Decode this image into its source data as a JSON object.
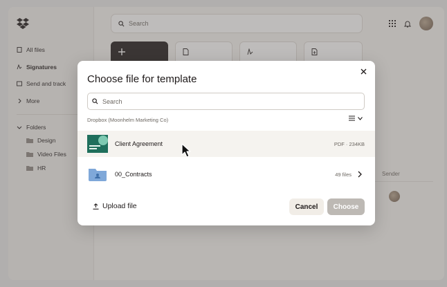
{
  "app": {
    "sidebar": {
      "items": [
        {
          "label": "All files",
          "icon": "file-icon"
        },
        {
          "label": "Signatures",
          "icon": "signature-icon"
        },
        {
          "label": "Send and track",
          "icon": "send-icon"
        },
        {
          "label": "More",
          "icon": "chevron-right-icon"
        }
      ],
      "folders_label": "Folders",
      "folders": [
        {
          "label": "Design"
        },
        {
          "label": "Video Files"
        },
        {
          "label": "HR"
        }
      ]
    },
    "header": {
      "search_placeholder": "Search"
    },
    "table": {
      "sender_header": "Sender"
    }
  },
  "modal": {
    "title": "Choose file for template",
    "search_placeholder": "Search",
    "breadcrumb": "Dropbox (Moonhelm Marketing Co)",
    "files": [
      {
        "name": "Client Agreement",
        "meta": "PDF · 234KB",
        "selected": true,
        "kind": "document"
      },
      {
        "name": "00_Contracts",
        "meta": "49 files",
        "selected": false,
        "kind": "folder"
      }
    ],
    "upload_label": "Upload file",
    "cancel_label": "Cancel",
    "choose_label": "Choose"
  },
  "colors": {
    "overlay": "#64605c",
    "primary_disabled": "#bdb9b4",
    "secondary_button": "#f1ede7",
    "folder": "#7fa8d9",
    "thumbnail": "#1f6f5c"
  }
}
